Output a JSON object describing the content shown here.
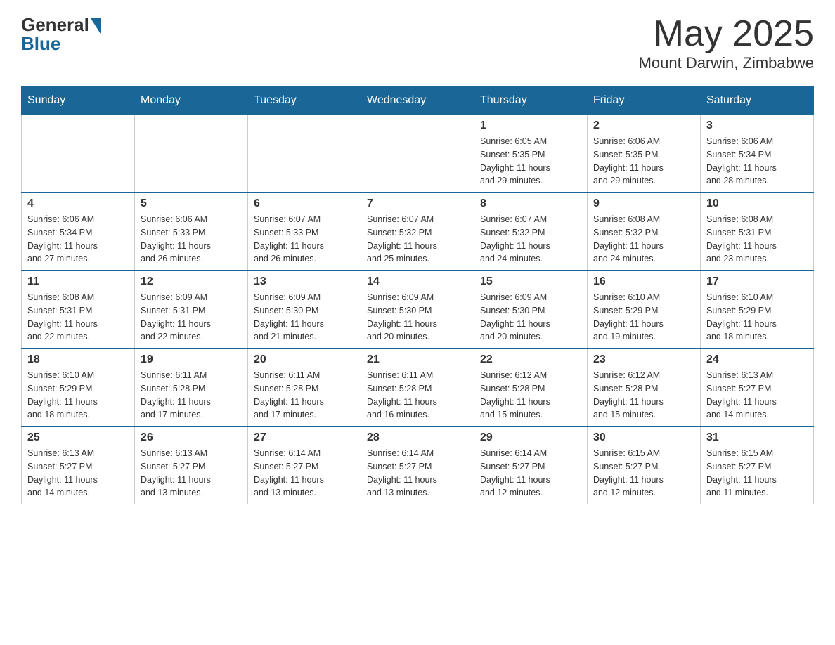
{
  "header": {
    "logo_general": "General",
    "logo_blue": "Blue",
    "main_title": "May 2025",
    "subtitle": "Mount Darwin, Zimbabwe"
  },
  "calendar": {
    "days_of_week": [
      "Sunday",
      "Monday",
      "Tuesday",
      "Wednesday",
      "Thursday",
      "Friday",
      "Saturday"
    ],
    "weeks": [
      [
        {
          "day": "",
          "info": ""
        },
        {
          "day": "",
          "info": ""
        },
        {
          "day": "",
          "info": ""
        },
        {
          "day": "",
          "info": ""
        },
        {
          "day": "1",
          "info": "Sunrise: 6:05 AM\nSunset: 5:35 PM\nDaylight: 11 hours\nand 29 minutes."
        },
        {
          "day": "2",
          "info": "Sunrise: 6:06 AM\nSunset: 5:35 PM\nDaylight: 11 hours\nand 29 minutes."
        },
        {
          "day": "3",
          "info": "Sunrise: 6:06 AM\nSunset: 5:34 PM\nDaylight: 11 hours\nand 28 minutes."
        }
      ],
      [
        {
          "day": "4",
          "info": "Sunrise: 6:06 AM\nSunset: 5:34 PM\nDaylight: 11 hours\nand 27 minutes."
        },
        {
          "day": "5",
          "info": "Sunrise: 6:06 AM\nSunset: 5:33 PM\nDaylight: 11 hours\nand 26 minutes."
        },
        {
          "day": "6",
          "info": "Sunrise: 6:07 AM\nSunset: 5:33 PM\nDaylight: 11 hours\nand 26 minutes."
        },
        {
          "day": "7",
          "info": "Sunrise: 6:07 AM\nSunset: 5:32 PM\nDaylight: 11 hours\nand 25 minutes."
        },
        {
          "day": "8",
          "info": "Sunrise: 6:07 AM\nSunset: 5:32 PM\nDaylight: 11 hours\nand 24 minutes."
        },
        {
          "day": "9",
          "info": "Sunrise: 6:08 AM\nSunset: 5:32 PM\nDaylight: 11 hours\nand 24 minutes."
        },
        {
          "day": "10",
          "info": "Sunrise: 6:08 AM\nSunset: 5:31 PM\nDaylight: 11 hours\nand 23 minutes."
        }
      ],
      [
        {
          "day": "11",
          "info": "Sunrise: 6:08 AM\nSunset: 5:31 PM\nDaylight: 11 hours\nand 22 minutes."
        },
        {
          "day": "12",
          "info": "Sunrise: 6:09 AM\nSunset: 5:31 PM\nDaylight: 11 hours\nand 22 minutes."
        },
        {
          "day": "13",
          "info": "Sunrise: 6:09 AM\nSunset: 5:30 PM\nDaylight: 11 hours\nand 21 minutes."
        },
        {
          "day": "14",
          "info": "Sunrise: 6:09 AM\nSunset: 5:30 PM\nDaylight: 11 hours\nand 20 minutes."
        },
        {
          "day": "15",
          "info": "Sunrise: 6:09 AM\nSunset: 5:30 PM\nDaylight: 11 hours\nand 20 minutes."
        },
        {
          "day": "16",
          "info": "Sunrise: 6:10 AM\nSunset: 5:29 PM\nDaylight: 11 hours\nand 19 minutes."
        },
        {
          "day": "17",
          "info": "Sunrise: 6:10 AM\nSunset: 5:29 PM\nDaylight: 11 hours\nand 18 minutes."
        }
      ],
      [
        {
          "day": "18",
          "info": "Sunrise: 6:10 AM\nSunset: 5:29 PM\nDaylight: 11 hours\nand 18 minutes."
        },
        {
          "day": "19",
          "info": "Sunrise: 6:11 AM\nSunset: 5:28 PM\nDaylight: 11 hours\nand 17 minutes."
        },
        {
          "day": "20",
          "info": "Sunrise: 6:11 AM\nSunset: 5:28 PM\nDaylight: 11 hours\nand 17 minutes."
        },
        {
          "day": "21",
          "info": "Sunrise: 6:11 AM\nSunset: 5:28 PM\nDaylight: 11 hours\nand 16 minutes."
        },
        {
          "day": "22",
          "info": "Sunrise: 6:12 AM\nSunset: 5:28 PM\nDaylight: 11 hours\nand 15 minutes."
        },
        {
          "day": "23",
          "info": "Sunrise: 6:12 AM\nSunset: 5:28 PM\nDaylight: 11 hours\nand 15 minutes."
        },
        {
          "day": "24",
          "info": "Sunrise: 6:13 AM\nSunset: 5:27 PM\nDaylight: 11 hours\nand 14 minutes."
        }
      ],
      [
        {
          "day": "25",
          "info": "Sunrise: 6:13 AM\nSunset: 5:27 PM\nDaylight: 11 hours\nand 14 minutes."
        },
        {
          "day": "26",
          "info": "Sunrise: 6:13 AM\nSunset: 5:27 PM\nDaylight: 11 hours\nand 13 minutes."
        },
        {
          "day": "27",
          "info": "Sunrise: 6:14 AM\nSunset: 5:27 PM\nDaylight: 11 hours\nand 13 minutes."
        },
        {
          "day": "28",
          "info": "Sunrise: 6:14 AM\nSunset: 5:27 PM\nDaylight: 11 hours\nand 13 minutes."
        },
        {
          "day": "29",
          "info": "Sunrise: 6:14 AM\nSunset: 5:27 PM\nDaylight: 11 hours\nand 12 minutes."
        },
        {
          "day": "30",
          "info": "Sunrise: 6:15 AM\nSunset: 5:27 PM\nDaylight: 11 hours\nand 12 minutes."
        },
        {
          "day": "31",
          "info": "Sunrise: 6:15 AM\nSunset: 5:27 PM\nDaylight: 11 hours\nand 11 minutes."
        }
      ]
    ]
  }
}
